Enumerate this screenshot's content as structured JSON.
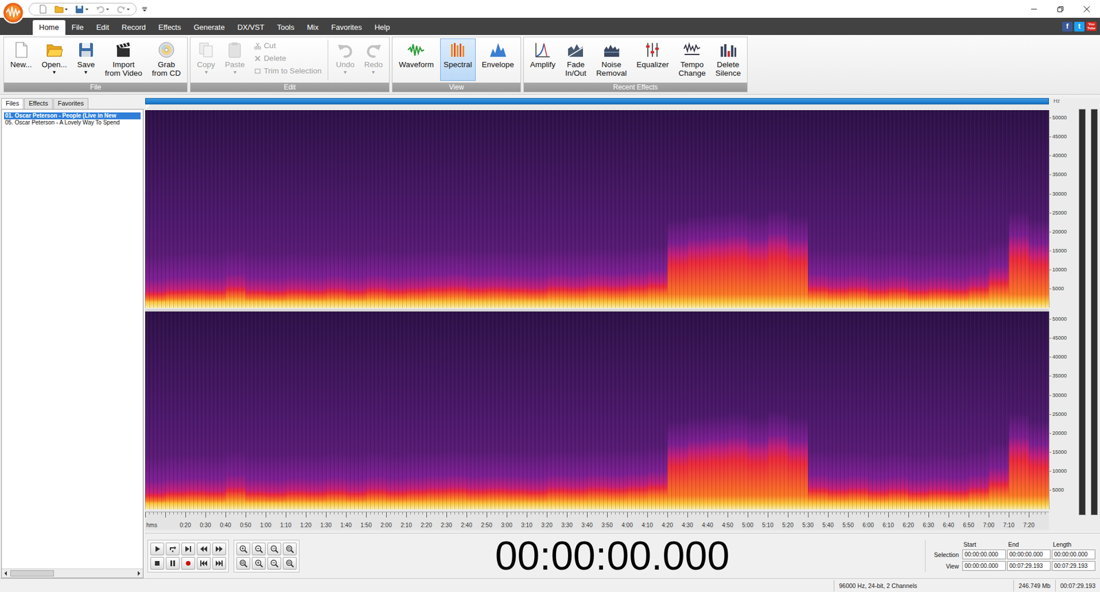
{
  "menu": [
    {
      "label": "Home",
      "selected": true
    },
    {
      "label": "File",
      "selected": false
    },
    {
      "label": "Edit",
      "selected": false
    },
    {
      "label": "Record",
      "selected": false
    },
    {
      "label": "Effects",
      "selected": false
    },
    {
      "label": "Generate",
      "selected": false
    },
    {
      "label": "DX/VST",
      "selected": false
    },
    {
      "label": "Tools",
      "selected": false
    },
    {
      "label": "Mix",
      "selected": false
    },
    {
      "label": "Favorites",
      "selected": false
    },
    {
      "label": "Help",
      "selected": false
    }
  ],
  "social": [
    {
      "label": "f",
      "color": "#3b5998"
    },
    {
      "label": "t",
      "color": "#1da1f2"
    },
    {
      "label": "You Tube",
      "color": "#d42a20"
    }
  ],
  "ribbon": {
    "groups": [
      {
        "label": "File",
        "buttons": [
          {
            "lines": [
              "New..."
            ],
            "kind": "large",
            "disabled": false,
            "selected": false
          },
          {
            "lines": [
              "Open..."
            ],
            "arrow": "▾",
            "kind": "large",
            "disabled": false,
            "selected": false
          },
          {
            "lines": [
              "Save"
            ],
            "arrow": "▾",
            "kind": "large",
            "disabled": false,
            "selected": false
          },
          {
            "lines": [
              "Import",
              "from Video"
            ],
            "kind": "large",
            "disabled": false,
            "selected": false
          },
          {
            "lines": [
              "Grab",
              "from CD"
            ],
            "kind": "large",
            "disabled": false,
            "selected": false
          }
        ]
      },
      {
        "label": "Edit",
        "buttons": [
          {
            "lines": [
              "Copy"
            ],
            "arrow": "▾",
            "kind": "large",
            "disabled": true,
            "selected": false
          },
          {
            "lines": [
              "Paste"
            ],
            "arrow": "▾",
            "kind": "large",
            "disabled": true,
            "selected": false
          },
          {
            "lines": [
              "Cut"
            ],
            "kind": "small",
            "disabled": true,
            "selected": false
          },
          {
            "lines": [
              "Delete"
            ],
            "kind": "small",
            "disabled": true,
            "selected": false
          },
          {
            "lines": [
              "Trim to Selection"
            ],
            "kind": "small",
            "disabled": true,
            "selected": false
          },
          {
            "lines": [
              "Undo"
            ],
            "arrow": "▾",
            "kind": "large",
            "disabled": true,
            "selected": false
          },
          {
            "lines": [
              "Redo"
            ],
            "arrow": "▾",
            "kind": "large",
            "disabled": true,
            "selected": false
          }
        ]
      },
      {
        "label": "View",
        "buttons": [
          {
            "lines": [
              "Waveform"
            ],
            "kind": "large",
            "disabled": false,
            "selected": false
          },
          {
            "lines": [
              "Spectral"
            ],
            "kind": "large",
            "disabled": false,
            "selected": true
          },
          {
            "lines": [
              "Envelope"
            ],
            "kind": "large",
            "disabled": false,
            "selected": false
          }
        ]
      },
      {
        "label": "Recent Effects",
        "buttons": [
          {
            "lines": [
              "Amplify"
            ],
            "kind": "large",
            "disabled": false,
            "selected": false
          },
          {
            "lines": [
              "Fade",
              "In/Out"
            ],
            "kind": "large",
            "disabled": false,
            "selected": false
          },
          {
            "lines": [
              "Noise",
              "Removal"
            ],
            "kind": "large",
            "disabled": false,
            "selected": false
          },
          {
            "lines": [
              "Equalizer"
            ],
            "kind": "large",
            "disabled": false,
            "selected": false
          },
          {
            "lines": [
              "Tempo",
              "Change"
            ],
            "kind": "large",
            "disabled": false,
            "selected": false
          },
          {
            "lines": [
              "Delete",
              "Silence"
            ],
            "kind": "large",
            "disabled": false,
            "selected": false
          }
        ]
      }
    ]
  },
  "sidebar": {
    "tabs": [
      {
        "label": "Files",
        "selected": true
      },
      {
        "label": "Effects",
        "selected": false
      },
      {
        "label": "Favorites",
        "selected": false
      }
    ],
    "items": [
      {
        "label": "01. Oscar Peterson - People (Live in New",
        "selected": true
      },
      {
        "label": "05. Oscar Peterson - A Lovely Way To Spend",
        "selected": false
      }
    ],
    "scrollbar": {
      "level": 0.35
    }
  },
  "editor": {
    "axis": {
      "unit": "Hz",
      "labels": [
        "50000",
        "45000",
        "40000",
        "35000",
        "30000",
        "25000",
        "20000",
        "15000",
        "10000",
        "5000"
      ]
    },
    "channels": [
      {
        "band_top_hz": [
          4500,
          5000,
          5200,
          5000,
          6000,
          5000,
          4800,
          5200,
          5000,
          5400,
          5000,
          5600,
          5200,
          5500,
          5800,
          6000,
          5600,
          5800,
          5600,
          5400,
          6000,
          5800,
          6200,
          6000,
          6400,
          7000,
          14000,
          15000,
          15500,
          16000,
          15000,
          16500,
          15000,
          6000,
          5500,
          5800,
          5200,
          5600,
          5000,
          5400,
          5200,
          6000,
          8000,
          16000,
          14000
        ]
      },
      {
        "band_top_hz": [
          4500,
          5000,
          5200,
          5000,
          6000,
          5000,
          4800,
          5200,
          5000,
          5400,
          5000,
          5600,
          5200,
          5500,
          5800,
          6000,
          5600,
          5800,
          5600,
          5400,
          6000,
          5800,
          6200,
          6000,
          6400,
          7000,
          14000,
          15000,
          15500,
          16000,
          15000,
          16500,
          15000,
          6000,
          5500,
          5800,
          5200,
          5600,
          5000,
          5400,
          5200,
          6000,
          8000,
          16000,
          14000
        ]
      }
    ],
    "ruler": {
      "unit": "hms",
      "labels": [
        "0:20",
        "0:30",
        "0:40",
        "0:50",
        "1:00",
        "1:10",
        "1:20",
        "1:30",
        "1:40",
        "1:50",
        "2:00",
        "2:10",
        "2:20",
        "2:30",
        "2:40",
        "2:50",
        "3:00",
        "3:10",
        "3:20",
        "3:30",
        "3:40",
        "3:50",
        "4:00",
        "4:10",
        "4:20",
        "4:30",
        "4:40",
        "4:50",
        "5:00",
        "5:10",
        "5:20",
        "5:30",
        "5:40",
        "5:50",
        "6:00",
        "6:10",
        "6:20",
        "6:30",
        "6:40",
        "6:50",
        "7:00",
        "7:10",
        "7:20"
      ]
    },
    "meter": {
      "levels": [
        0,
        0
      ]
    }
  },
  "transport": {
    "time": "00:00:00.000",
    "selection": {
      "columns": [
        "Start",
        "End",
        "Length"
      ],
      "rows": [
        {
          "label": "Selection",
          "values": [
            "00:00:00.000",
            "00:00:00.000",
            "00:00:00.000"
          ]
        },
        {
          "label": "View",
          "values": [
            "00:00:00.000",
            "00:07:29.193",
            "00:07:29.193"
          ]
        }
      ]
    }
  },
  "status_bar": [
    "96000 Hz, 24-bit, 2 Channels",
    "246.749 Mb",
    "00:07:29.193"
  ]
}
